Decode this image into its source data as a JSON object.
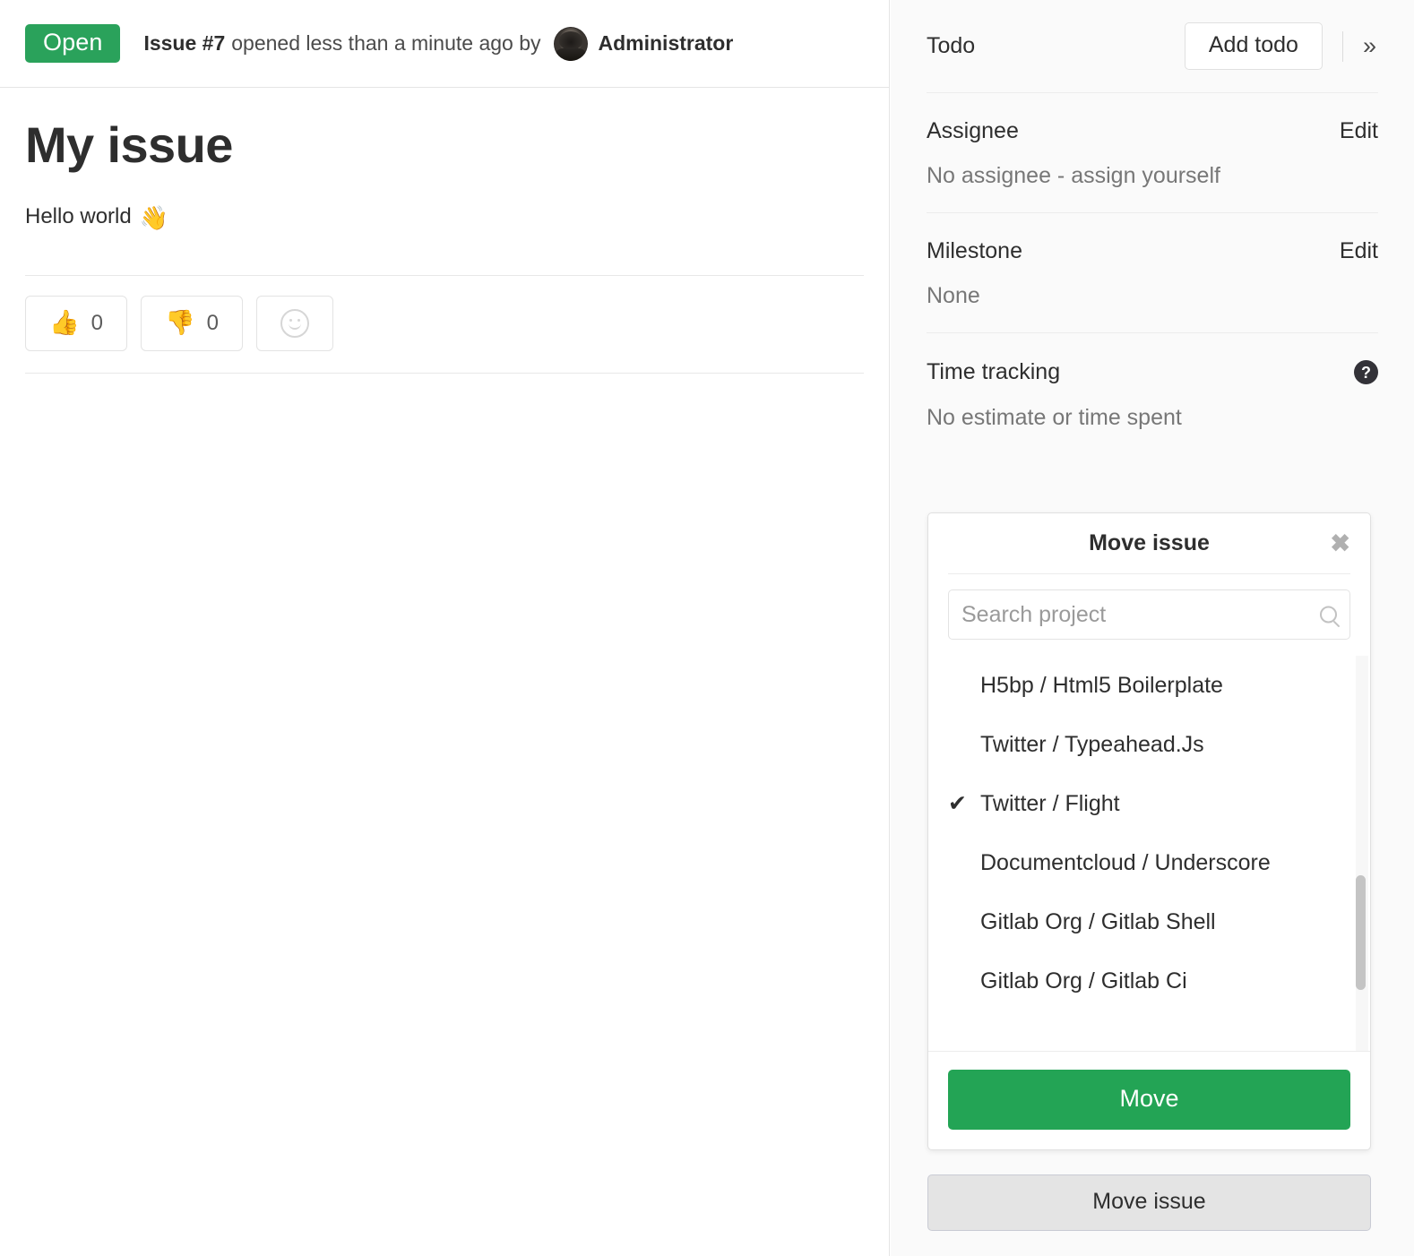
{
  "issue": {
    "status_badge": "Open",
    "reference": "Issue #7",
    "meta_text": "opened less than a minute ago by",
    "author": "Administrator",
    "title": "My issue",
    "description": "Hello world",
    "description_emoji": "👋"
  },
  "awards": [
    {
      "emoji": "👍",
      "count": "0",
      "name": "thumbsup"
    },
    {
      "emoji": "👎",
      "count": "0",
      "name": "thumbsdown"
    }
  ],
  "sidebar": {
    "todo": {
      "label": "Todo",
      "button": "Add todo",
      "collapse_icon": "»"
    },
    "assignee": {
      "title": "Assignee",
      "edit": "Edit",
      "value": "No assignee - ",
      "link": "assign yourself"
    },
    "milestone": {
      "title": "Milestone",
      "edit": "Edit",
      "value": "None"
    },
    "time_tracking": {
      "title": "Time tracking",
      "help_icon": "?",
      "value": "No estimate or time spent"
    }
  },
  "move_panel": {
    "title": "Move issue",
    "close_icon": "✖",
    "search_placeholder": "Search project",
    "search_value": "",
    "search_icon": "search-icon",
    "check_glyph": "✔",
    "projects": [
      {
        "label": "H5bp / Html5 Boilerplate",
        "selected": false
      },
      {
        "label": "Twitter / Typeahead.Js",
        "selected": false
      },
      {
        "label": "Twitter / Flight",
        "selected": true
      },
      {
        "label": "Documentcloud / Underscore",
        "selected": false
      },
      {
        "label": "Gitlab Org / Gitlab Shell",
        "selected": false
      },
      {
        "label": "Gitlab Org / Gitlab Ci",
        "selected": false
      }
    ],
    "move_button": "Move"
  },
  "move_issue_button": "Move issue",
  "colors": {
    "status_green": "#2aa25b",
    "move_green": "#23a455",
    "sidebar_bg": "#fafafa",
    "border": "#e5e5e5"
  }
}
